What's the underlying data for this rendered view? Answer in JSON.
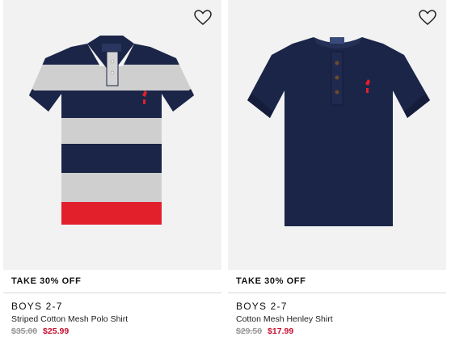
{
  "products": [
    {
      "promo": "TAKE 30% OFF",
      "category": "BOYS 2-7",
      "title": "Striped Cotton Mesh Polo Shirt",
      "original_price": "$35.00",
      "sale_price": "$25.99",
      "image_icon": "striped-polo-shirt-image",
      "wishlist_icon": "heart-icon"
    },
    {
      "promo": "TAKE 30% OFF",
      "category": "BOYS 2-7",
      "title": "Cotton Mesh Henley Shirt",
      "original_price": "$29.50",
      "sale_price": "$17.99",
      "image_icon": "henley-shirt-image",
      "wishlist_icon": "heart-icon"
    }
  ],
  "colors": {
    "navy": "#1b2548",
    "heather_grey": "#cfcfcf",
    "red": "#e2202c",
    "sale_red": "#c8102e",
    "image_bg": "#f2f2f2"
  }
}
